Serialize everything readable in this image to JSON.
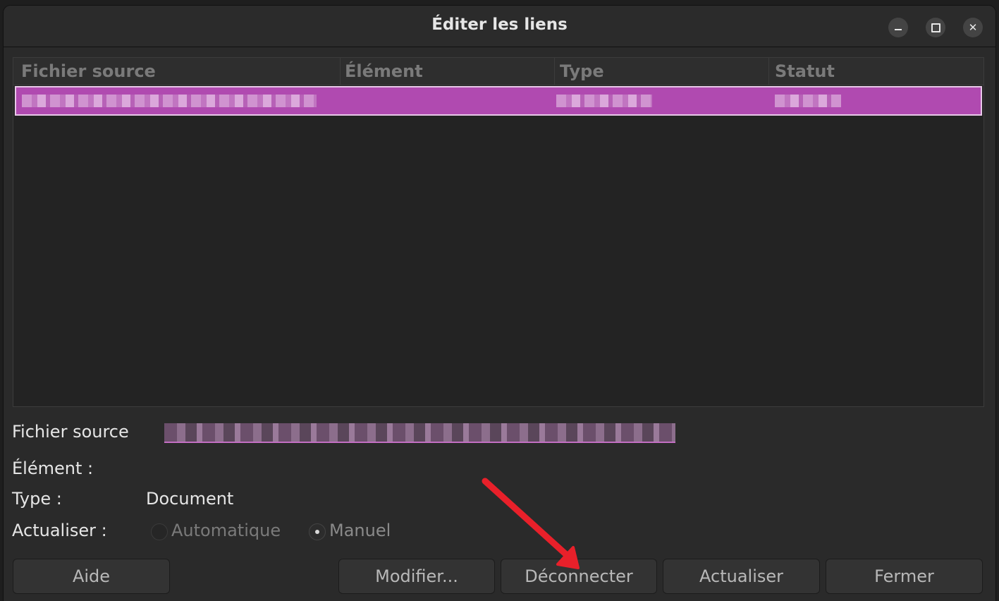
{
  "window": {
    "title": "Éditer les liens",
    "controls": {
      "minimize": "minimize-icon",
      "maximize": "maximize-icon",
      "close": "close-icon"
    }
  },
  "list": {
    "columns": [
      "Fichier source",
      "Élément",
      "Type",
      "Statut"
    ],
    "selected_row_color": "#b04ab0"
  },
  "details": {
    "source_label": "Fichier source",
    "element_label": "Élément :",
    "type_label": "Type :",
    "type_value": "Document",
    "update_label": "Actualiser :",
    "update_options": [
      "Automatique",
      "Manuel"
    ],
    "update_selected": "Manuel"
  },
  "buttons": {
    "help": "Aide",
    "modify": "Modifier...",
    "disconnect": "Déconnecter",
    "update": "Actualiser",
    "close": "Fermer"
  },
  "annotation": {
    "arrow_color": "#e8202a"
  }
}
